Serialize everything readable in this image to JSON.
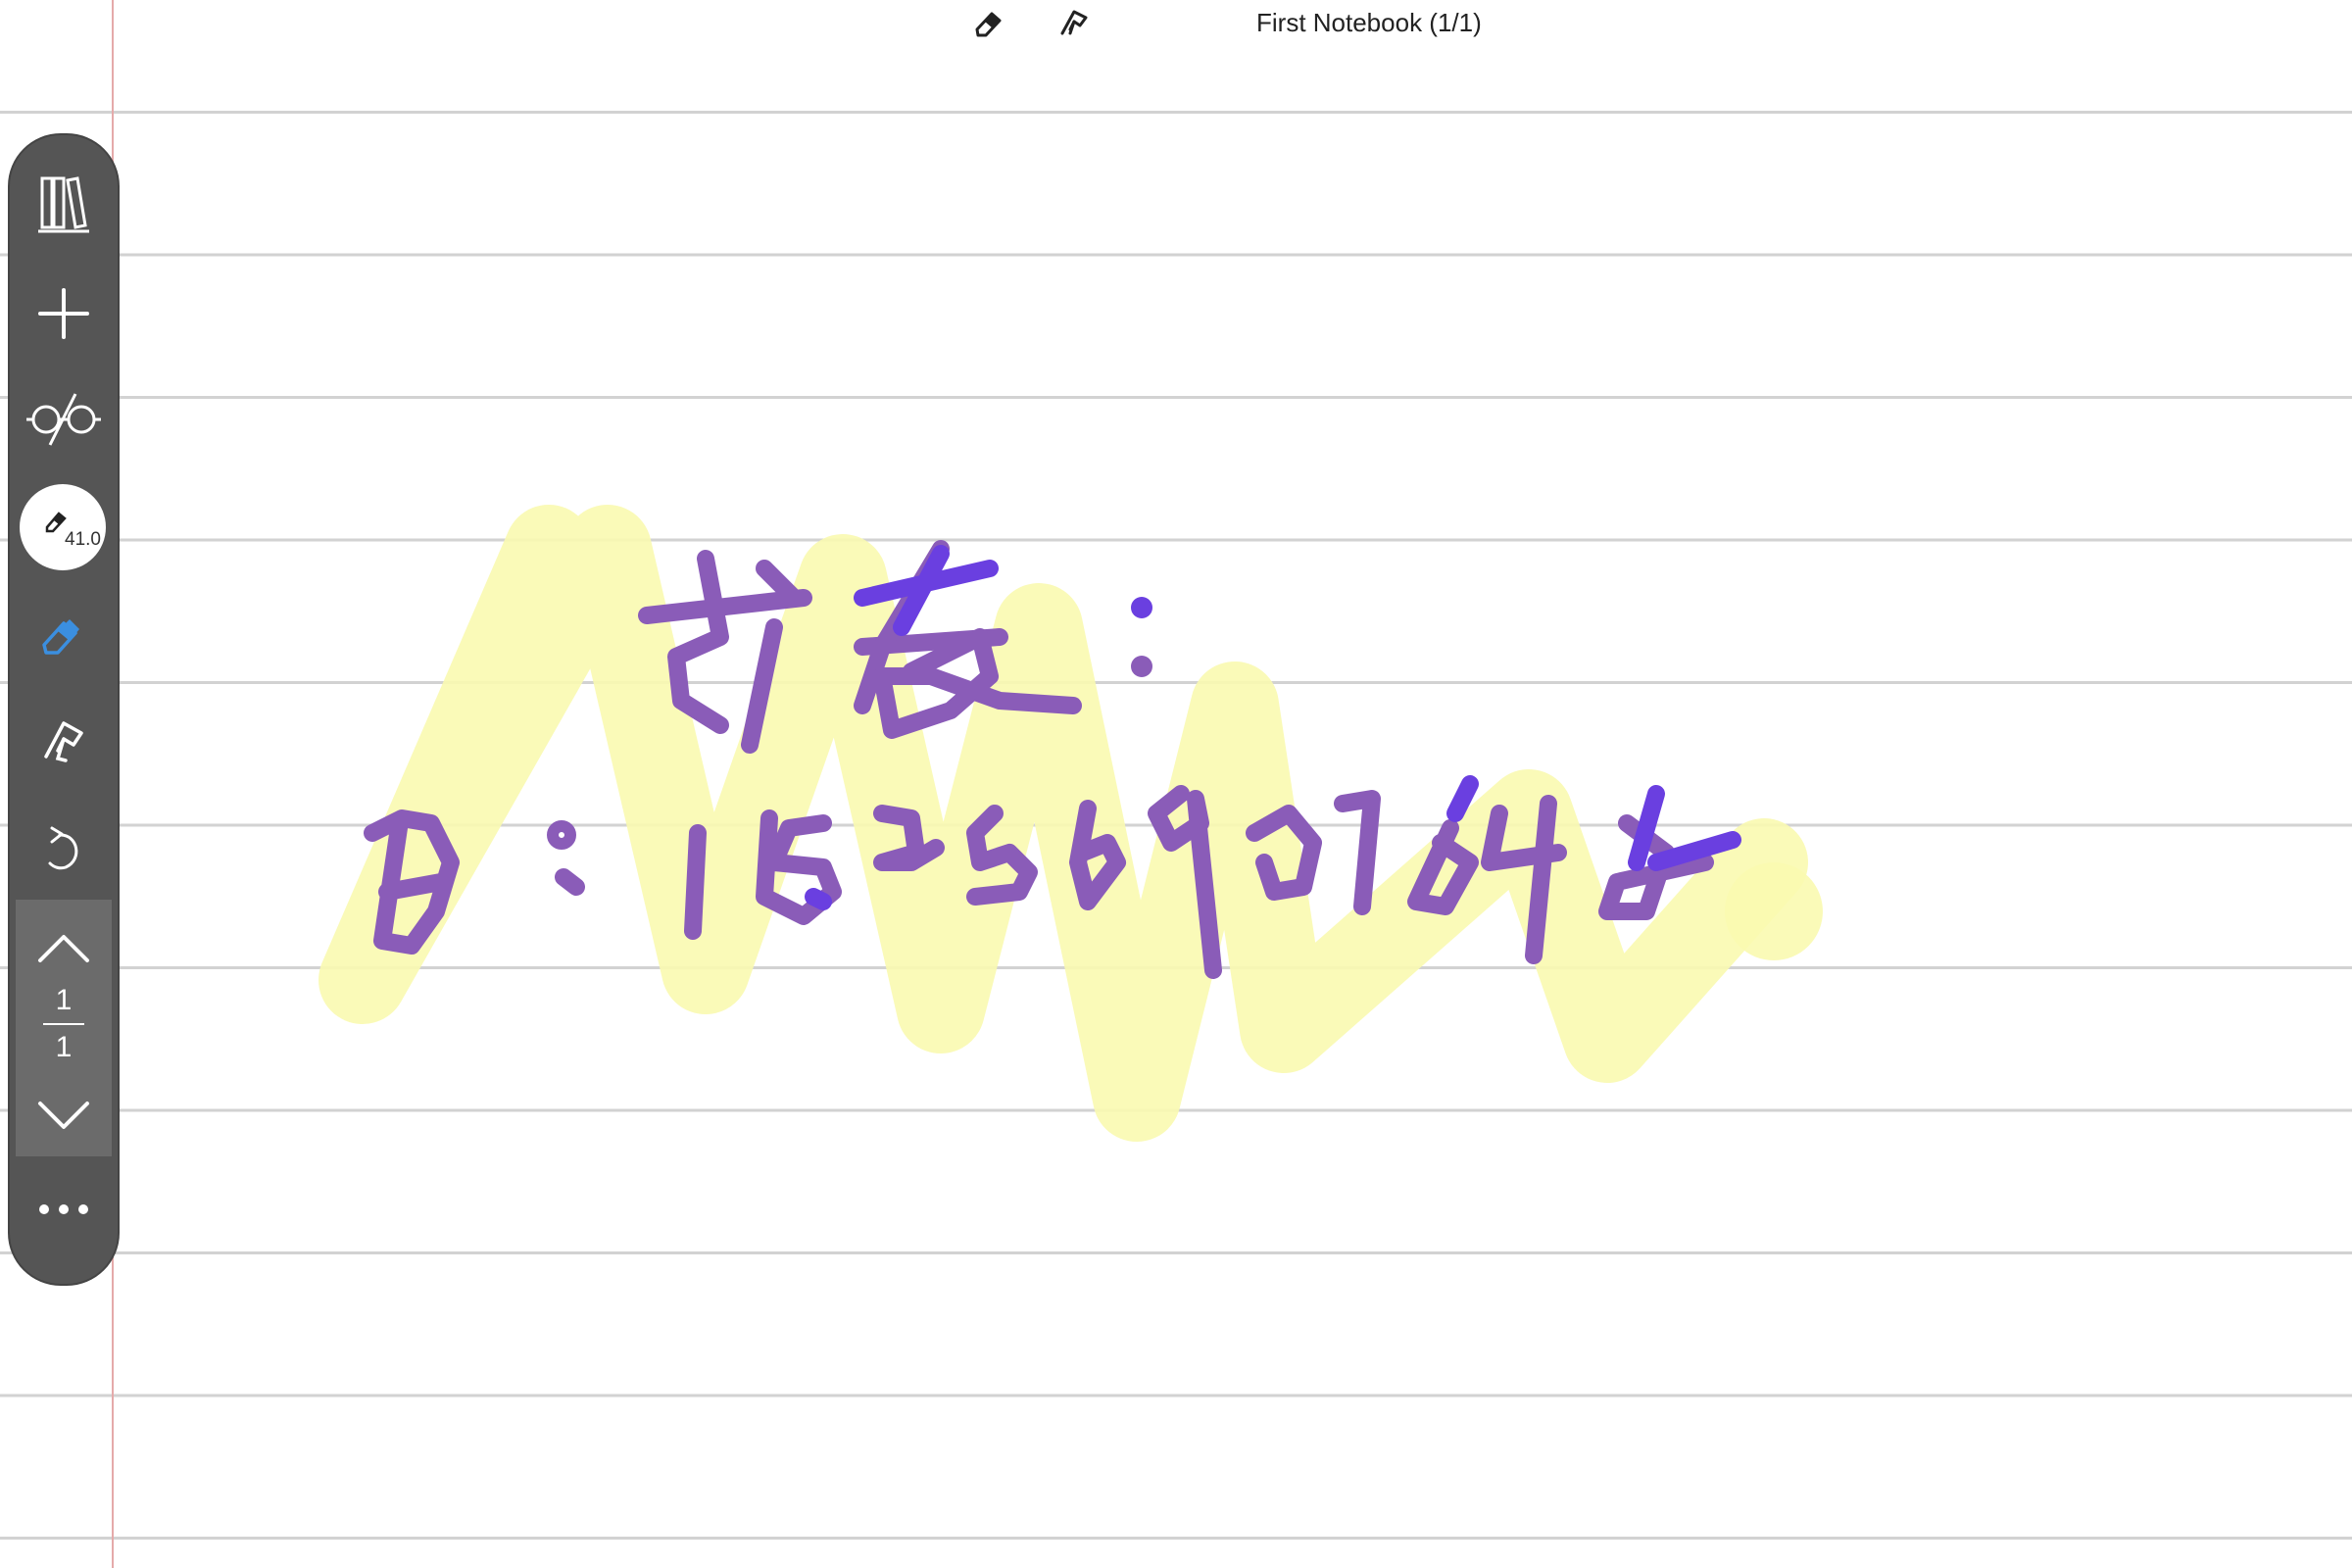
{
  "header": {
    "title": "First Notebook (1/1)",
    "icons": [
      "eraser-icon",
      "lasso-hand-icon"
    ]
  },
  "toolbar": {
    "items": [
      "library-icon",
      "add-page-icon",
      "read-mode-glasses-icon",
      "pen-tool",
      "eraser-tool",
      "lasso-hand-tool",
      "undo-icon",
      "page-up-icon",
      "page-down-icon",
      "more-icon"
    ],
    "pen_size": "41.0",
    "page": {
      "current": "1",
      "total": "1"
    }
  },
  "colors": {
    "toolbar_bg": "#555555",
    "ink_purple": "#8a5cb8",
    "ink_violet": "#6a3fe0",
    "highlighter": "#fafab0",
    "eraser_accent": "#3b8fe0",
    "margin_line": "#e5aaaa",
    "ruled_line": "#d2d2d2"
  },
  "canvas": {
    "content": "handwritten note with yellow highlighter scribble"
  }
}
